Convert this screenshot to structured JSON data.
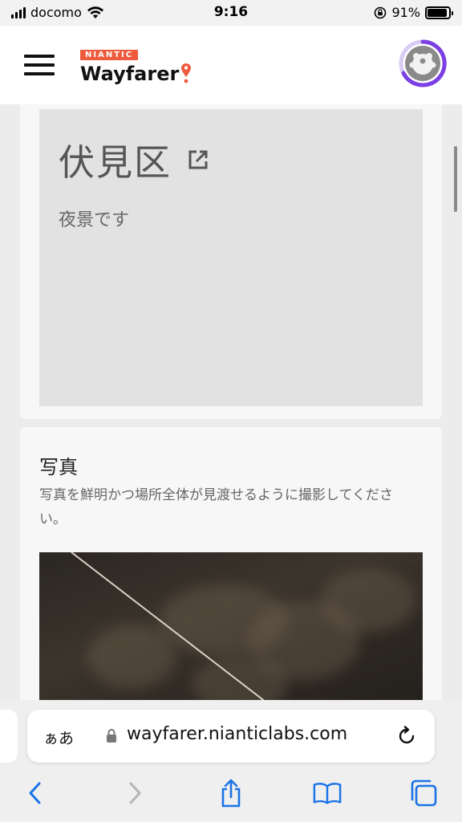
{
  "status_bar": {
    "carrier": "docomo",
    "time": "9:16",
    "battery_percent": "91%",
    "battery_level": 0.91
  },
  "header": {
    "brand_tag": "NIANTIC",
    "brand_name": "Wayfarer"
  },
  "place_card": {
    "title": "伏見区",
    "description": "夜景です"
  },
  "photo_card": {
    "title": "写真",
    "description": "写真を鮮明かつ場所全体が見渡せるように撮影してください。"
  },
  "browser": {
    "text_size_label": "ぁあ",
    "url": "wayfarer.nianticlabs.com"
  },
  "colors": {
    "accent_blue": "#1a73e8",
    "brand_orange": "#ef5a3c",
    "avatar_ring": "#7b3fe4"
  },
  "icons": [
    "menu-icon",
    "map-pin-icon",
    "avatar-icon",
    "external-link-icon",
    "lock-icon",
    "reload-icon",
    "back-icon",
    "forward-icon",
    "share-icon",
    "bookmarks-icon",
    "tabs-icon"
  ]
}
